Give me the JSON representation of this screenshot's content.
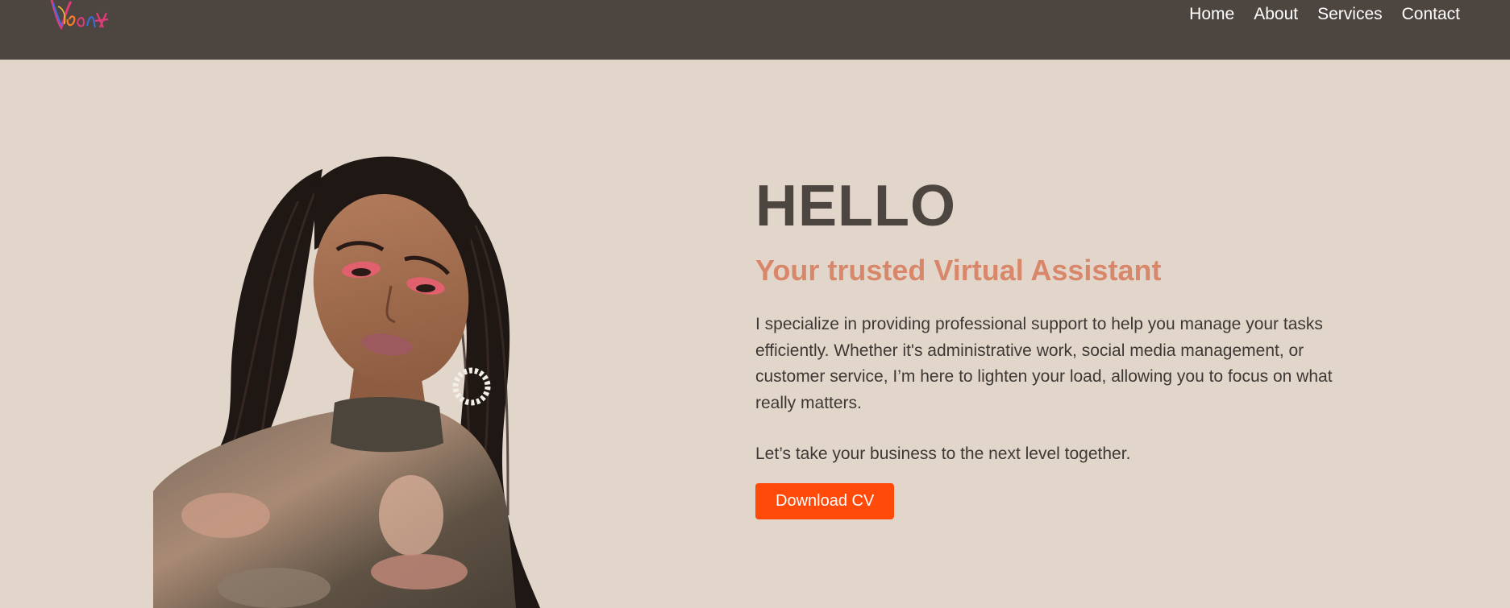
{
  "nav": {
    "links": [
      "Home",
      "About",
      "Services",
      "Contact"
    ]
  },
  "hero": {
    "greeting": "HELLO",
    "subtitle": "Your trusted Virtual Assistant",
    "bio": "I specialize in providing professional support to help you manage your tasks efficiently. Whether it's administrative work, social media management, or customer service, I’m here to lighten your load, allowing you to focus on what really matters.",
    "tagline": "Let’s take your business to the next level together.",
    "cta_label": "Download CV"
  },
  "colors": {
    "navbar_bg": "#4d4540",
    "page_bg": "#e2d6ca",
    "heading": "#4d4540",
    "accent": "#d9876a",
    "button": "#ff4a0a"
  }
}
